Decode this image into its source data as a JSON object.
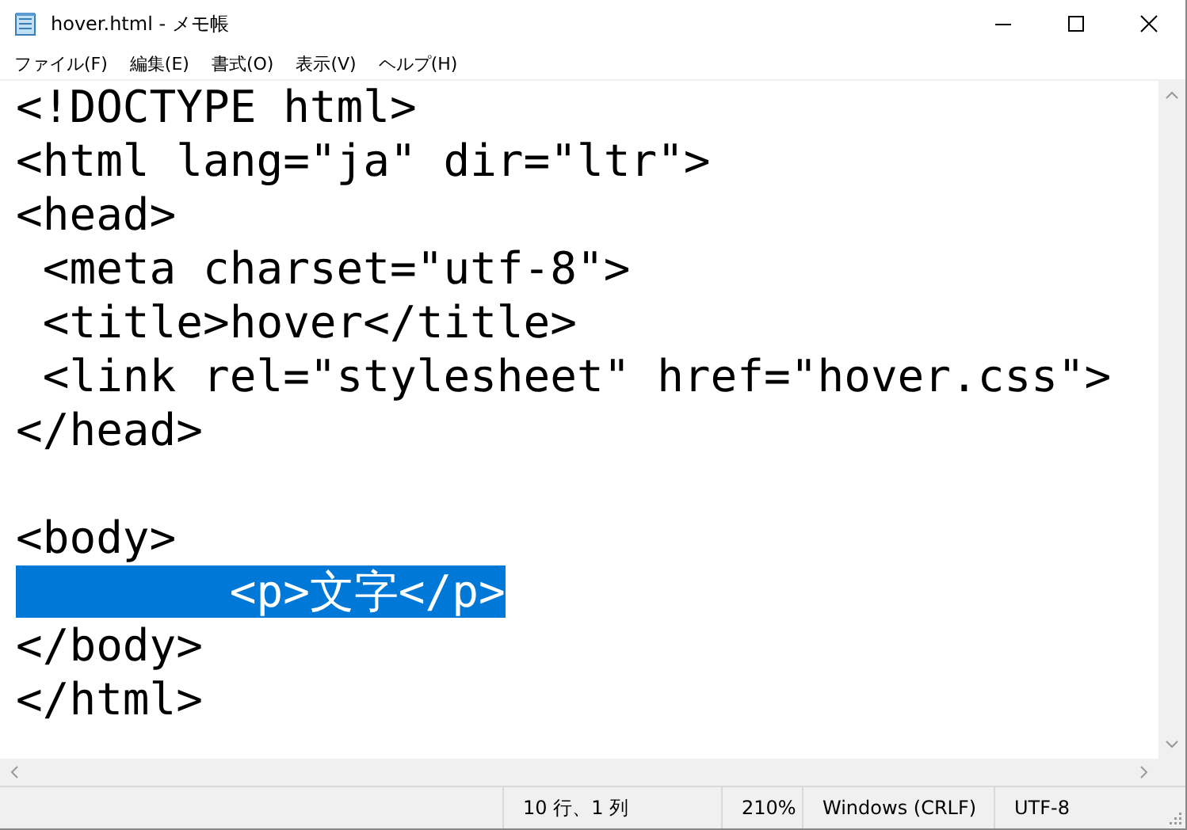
{
  "window": {
    "title": "hover.html - メモ帳"
  },
  "menu": [
    "ファイル(F)",
    "編集(E)",
    "書式(O)",
    "表示(V)",
    "ヘルプ(H)"
  ],
  "editor": {
    "lines": [
      {
        "text": "<!DOCTYPE html>",
        "selected": false
      },
      {
        "text": "<html lang=\"ja\" dir=\"ltr\">",
        "selected": false
      },
      {
        "text": "<head>",
        "selected": false
      },
      {
        "text": " <meta charset=\"utf-8\">",
        "selected": false
      },
      {
        "text": " <title>hover</title>",
        "selected": false
      },
      {
        "text": " <link rel=\"stylesheet\" href=\"hover.css\">",
        "selected": false
      },
      {
        "text": "</head>",
        "selected": false
      },
      {
        "selected": false
      },
      {
        "text": "<body>",
        "selected": false
      },
      {
        "text": "\t<p>文字</p>",
        "selected": true
      },
      {
        "text": "</body>",
        "selected": false
      },
      {
        "text": "</html>",
        "selected": false
      }
    ]
  },
  "status_bar": {
    "position": "10 行、1 列",
    "zoom": "210%",
    "line_ending": "Windows (CRLF)",
    "encoding": "UTF-8"
  }
}
